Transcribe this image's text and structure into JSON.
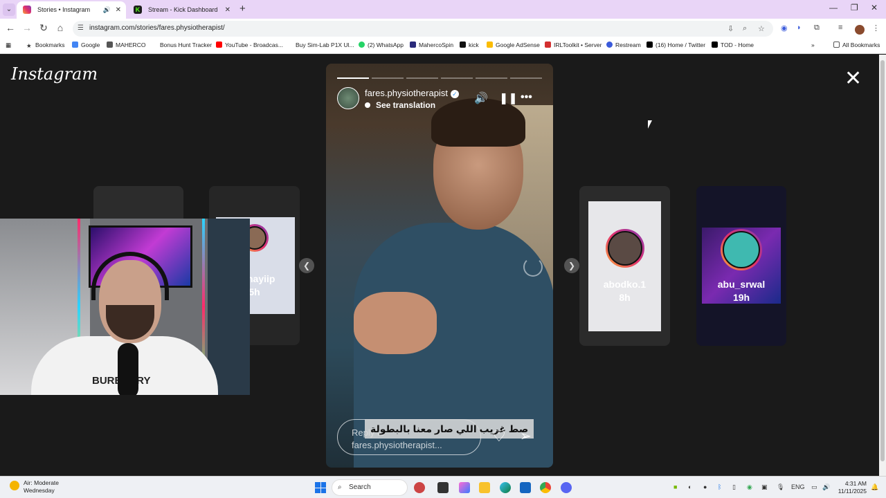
{
  "browser": {
    "tabs": [
      {
        "title": "Stories • Instagram",
        "active": true
      },
      {
        "title": "Stream - Kick Dashboard",
        "active": false
      }
    ],
    "url": "instagram.com/stories/fares.physiotherapist/",
    "bookmarks": [
      "Bookmarks",
      "Google",
      "MAHERCO",
      "Bonus Hunt Tracker",
      "YouTube - Broadcas...",
      "Buy Sim-Lab P1X Ul...",
      "(2) WhatsApp",
      "MahercoSpin",
      "kick",
      "Google AdSense",
      "IRLToolkit • Server",
      "Restream",
      "(16) Home / Twitter",
      "TOD - Home"
    ],
    "all_bookmarks": "All Bookmarks"
  },
  "instagram": {
    "logo": "Instagram",
    "story": {
      "username": "fares.physiotherapist",
      "translation": "See translation",
      "caption": "صط غريب اللي صار معنا بالبطولة",
      "reply_placeholder_prefix": "Reply to",
      "reply_placeholder_user": "fares.physiotherapist...",
      "segments_total": 6,
      "segments_done": 1
    },
    "side_stories": [
      {
        "name": "alshayiip",
        "time": "5h"
      },
      {
        "name": "abodko.1",
        "time": "8h"
      },
      {
        "name": "abu_srwal",
        "time": "19h"
      }
    ],
    "webcam_shirt_text": "BURBERRY"
  },
  "taskbar": {
    "weather_title": "Air: Moderate",
    "weather_sub": "Wednesday",
    "search": "Search",
    "lang": "ENG",
    "time": "4:31 AM",
    "date": "11/11/2025"
  },
  "colors": {
    "tabstrip": "#e9d5f7",
    "instagram_bg": "#1a1a1a",
    "story_ring": "#e1306c"
  }
}
